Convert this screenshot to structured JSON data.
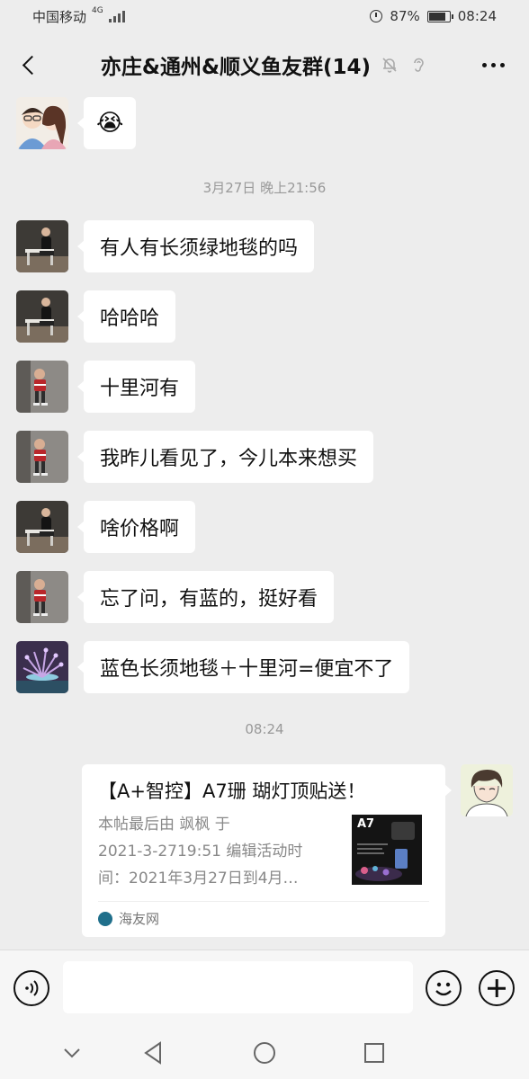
{
  "status_bar": {
    "carrier": "中国移动",
    "network": "4G",
    "battery": "87%",
    "battery_level": 0.87,
    "time": "08:24"
  },
  "header": {
    "title": "亦庄&通州&顺义鱼友群(14)"
  },
  "messages": [
    {
      "id": "m0",
      "sender_avatar": "couple-avatar",
      "content": "😭"
    },
    {
      "id": "m1",
      "sender_avatar": "man-sitting-avatar",
      "content": "有人有长须绿地毯的吗"
    },
    {
      "id": "m2",
      "sender_avatar": "man-sitting-avatar",
      "content": "哈哈哈"
    },
    {
      "id": "m3",
      "sender_avatar": "child-avatar",
      "content": "十里河有"
    },
    {
      "id": "m4",
      "sender_avatar": "child-avatar",
      "content": "我昨儿看见了，今儿本来想买"
    },
    {
      "id": "m5",
      "sender_avatar": "man-sitting-avatar",
      "content": "啥价格啊"
    },
    {
      "id": "m6",
      "sender_avatar": "child-avatar",
      "content": "忘了问，有蓝的，挺好看"
    },
    {
      "id": "m7",
      "sender_avatar": "coral-avatar",
      "content": "蓝色长须地毯＋十里河=便宜不了"
    }
  ],
  "timestamps": {
    "t1": "3月27日 晚上21:56",
    "t2": "08:24"
  },
  "link_card": {
    "title": "【A+智控】A7珊 瑚灯顶贴送！",
    "desc_lines": [
      "本帖最后由 飒枫 于",
      "2021-3-2719:51 编辑活动时",
      "间：2021年3月27日到4月…"
    ],
    "thumb_label": "A7",
    "source": "海友网"
  },
  "input": {
    "placeholder": ""
  }
}
